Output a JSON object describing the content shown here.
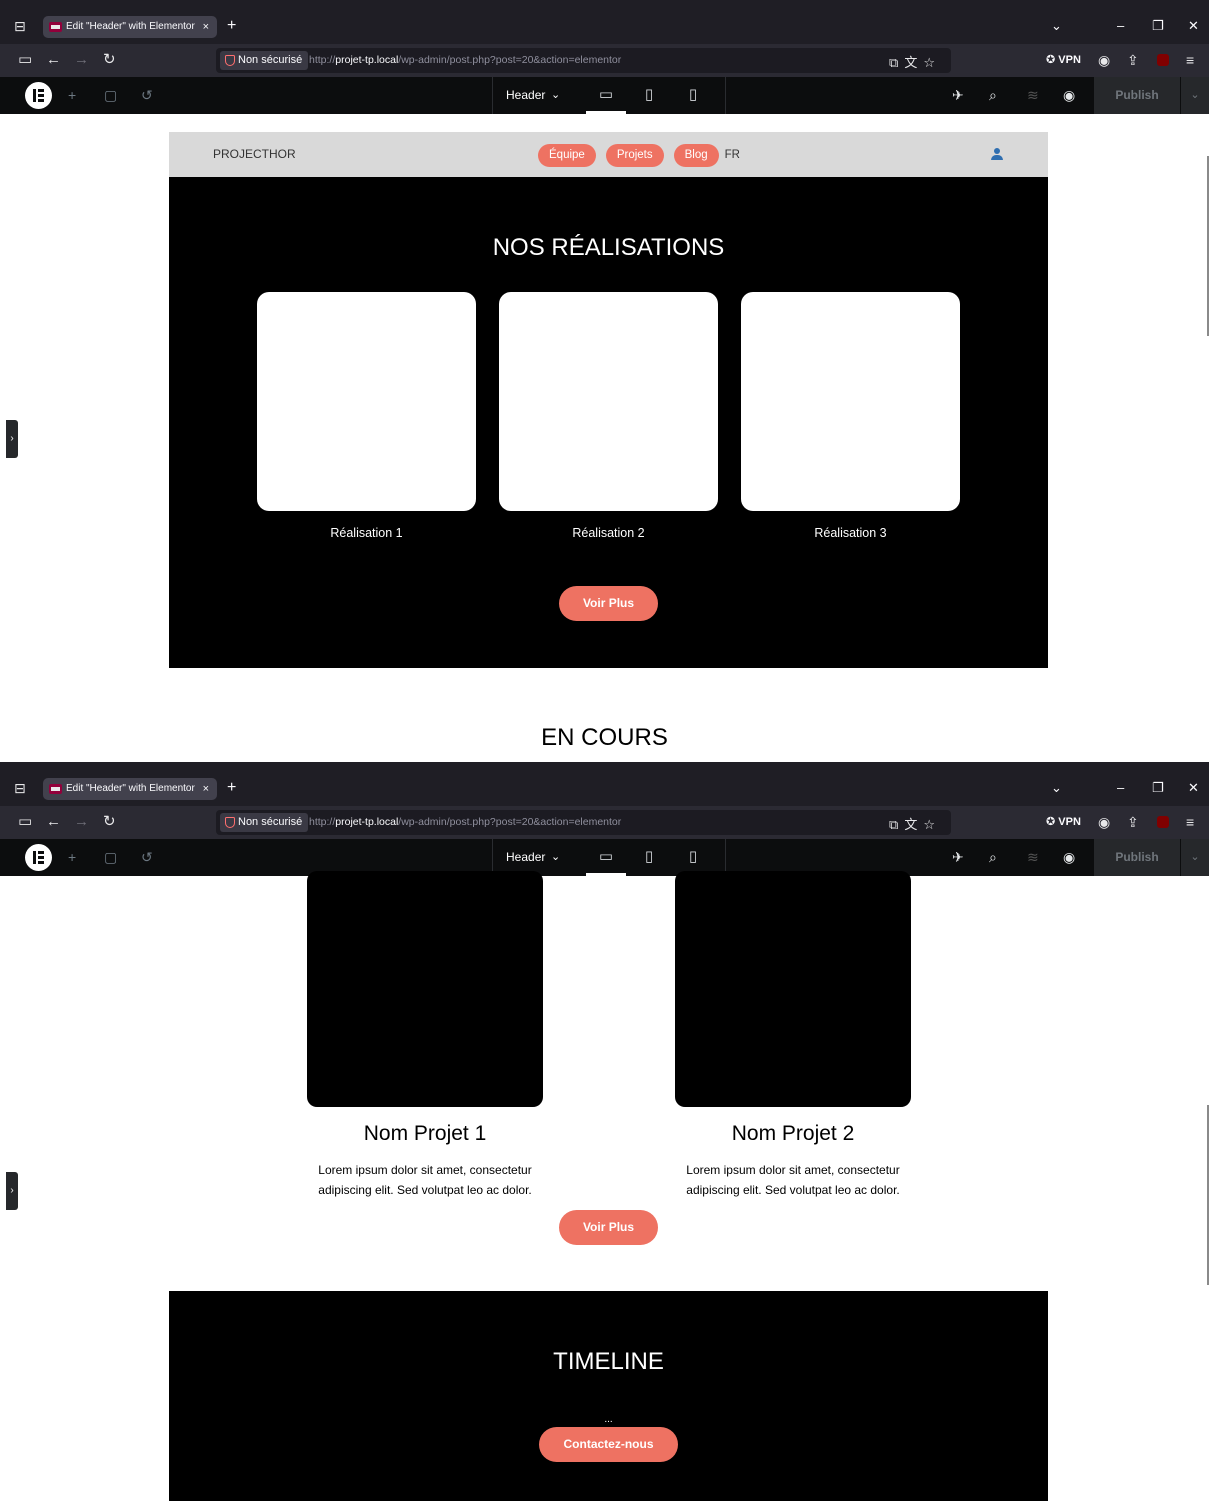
{
  "browser": {
    "tab_title": "Edit \"Header\" with Elementor",
    "tab_close": "×",
    "new_tab": "+",
    "security_label": "Non sécurisé",
    "url_prefix": "http://",
    "url_domain": "projet-tp.local",
    "url_path": "/wp-admin/post.php?post=20&action=elementor",
    "vpn_label": "VPN"
  },
  "editor": {
    "document_name": "Header",
    "publish_label": "Publish"
  },
  "site": {
    "brand": "PROJECTHOR",
    "menu": [
      "Équipe",
      "Projets",
      "Blog"
    ],
    "language": "FR"
  },
  "realisations": {
    "title": "NOS RÉALISATIONS",
    "items": [
      "Réalisation 1",
      "Réalisation 2",
      "Réalisation 3"
    ],
    "button": "Voir Plus"
  },
  "en_cours": {
    "title": "EN COURS",
    "projects": [
      {
        "name": "Nom Projet 1",
        "description": "Lorem ipsum dolor sit amet, consectetur adipiscing elit. Sed volutpat leo ac dolor."
      },
      {
        "name": "Nom Projet 2",
        "description": "Lorem ipsum dolor sit amet, consectetur adipiscing elit. Sed volutpat leo ac dolor."
      }
    ],
    "button": "Voir Plus"
  },
  "timeline": {
    "title": "TIMELINE",
    "placeholder": "...",
    "button": "Contactez-nous"
  },
  "colors": {
    "accent": "#ee7262",
    "header_bg": "#d9d9d9",
    "dark_section": "#000000",
    "user_icon": "#2f6eb0"
  }
}
